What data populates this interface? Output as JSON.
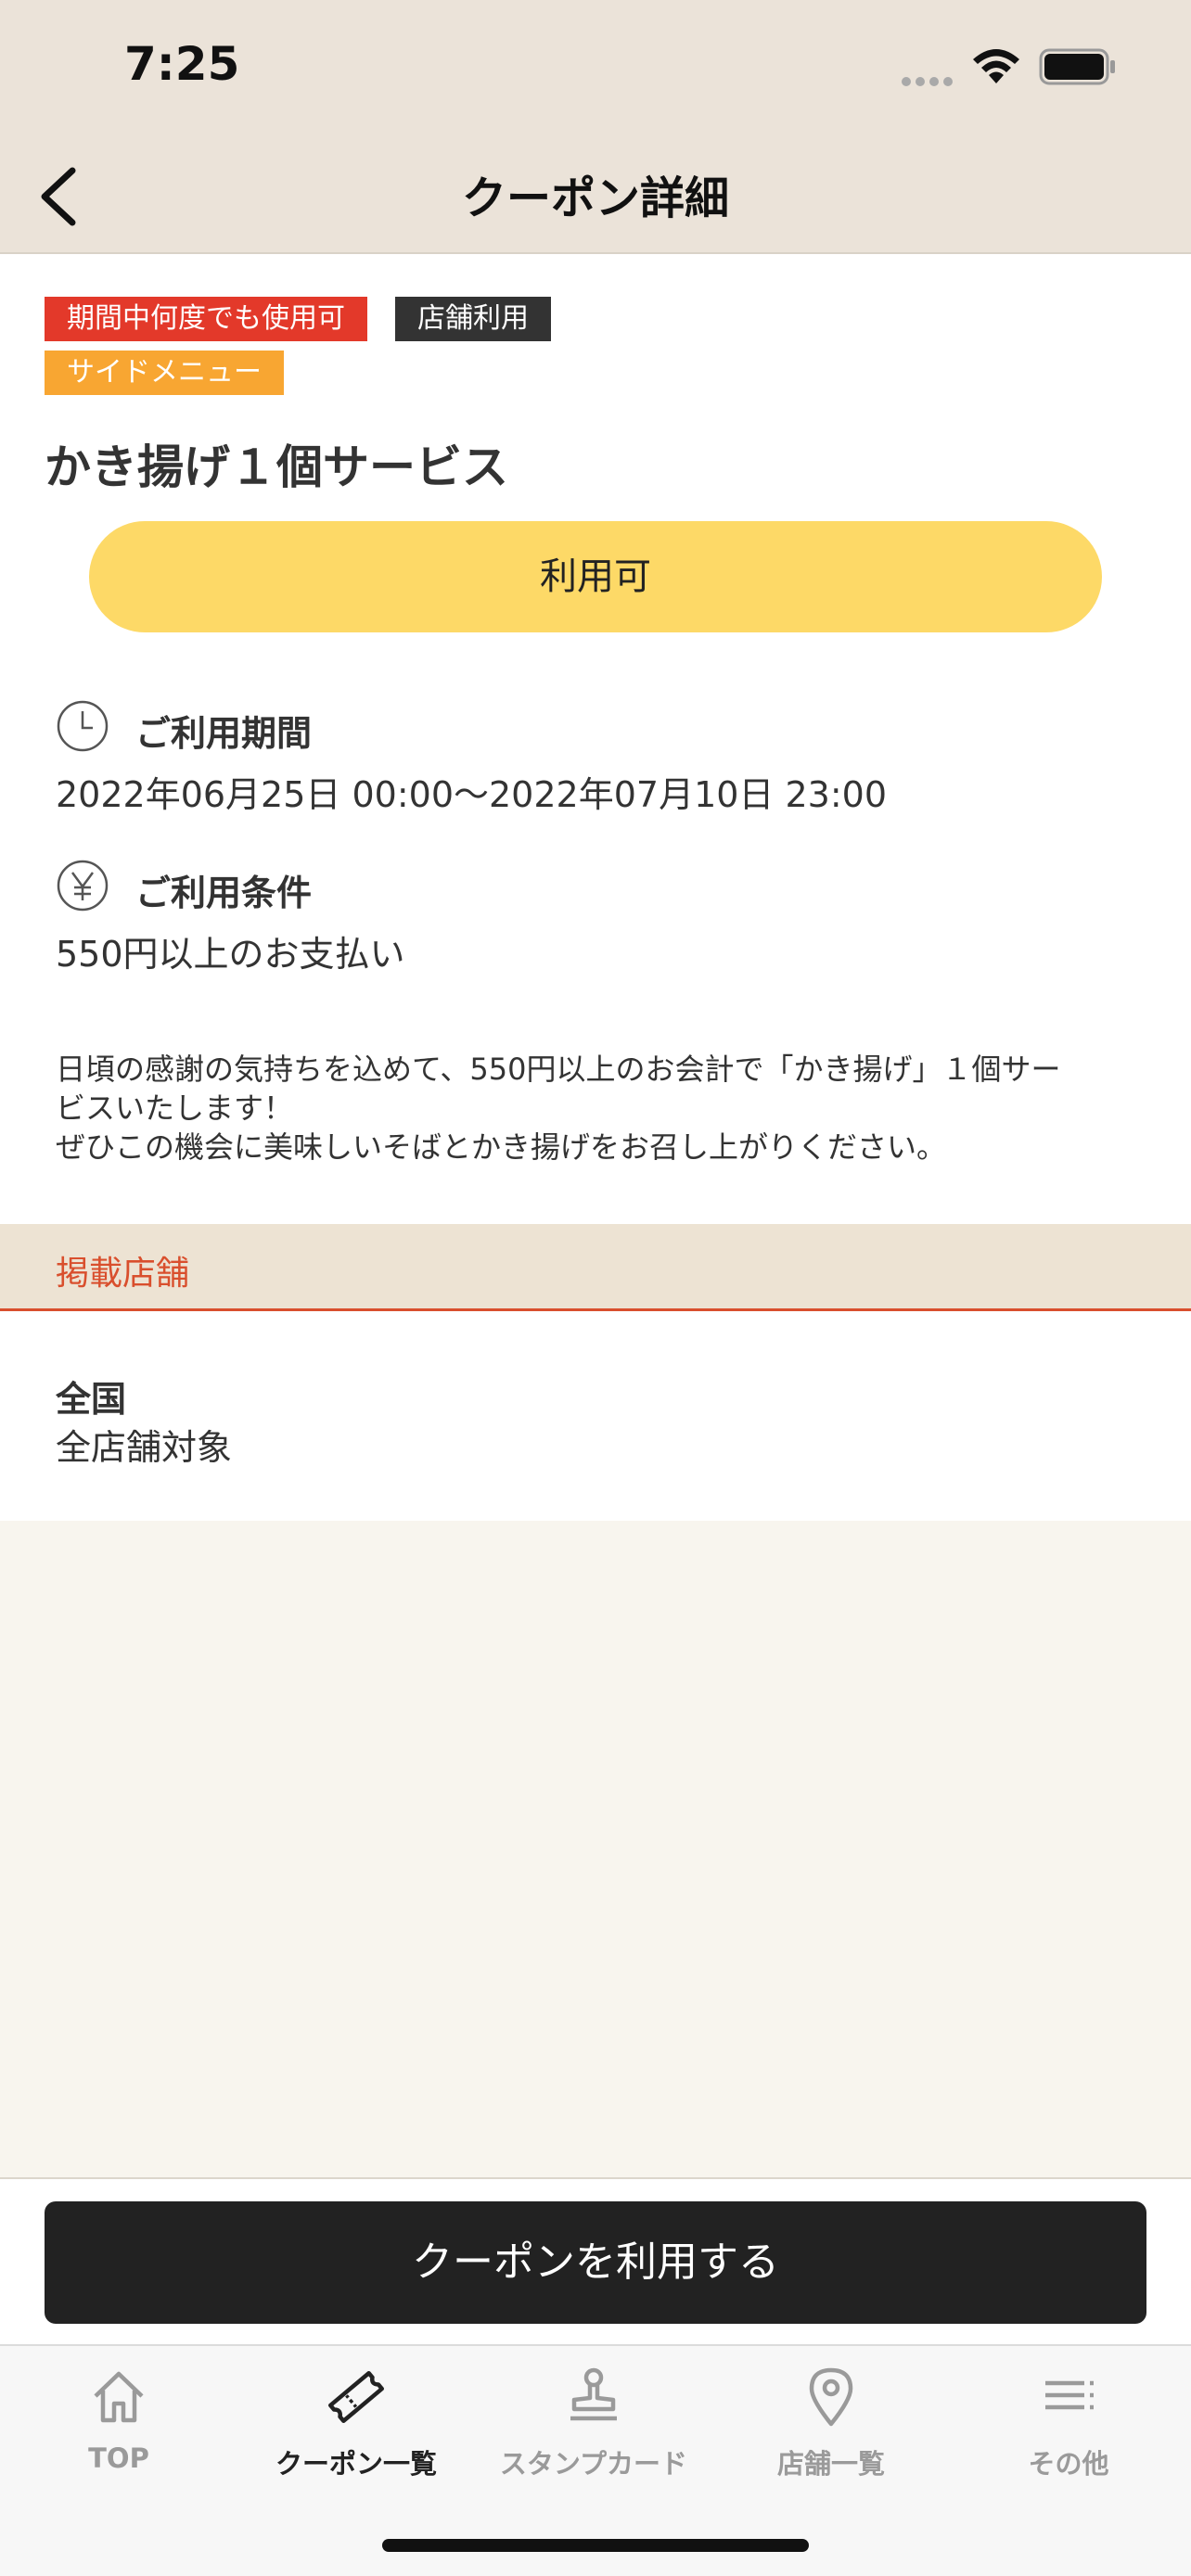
{
  "status_bar": {
    "time": "7:25"
  },
  "nav": {
    "title": "クーポン詳細"
  },
  "coupon": {
    "tags": [
      "期間中何度でも使用可",
      "店舗利用",
      "サイドメニュー"
    ],
    "title": "かき揚げ１個サービス",
    "status": "利用可",
    "period_label": "ご利用期間",
    "period_value": "2022年06月25日 00:00～2022年07月10日 23:00",
    "condition_label": "ご利用条件",
    "condition_value": "550円以上のお支払い",
    "description_lines": [
      "日頃の感謝の気持ちを込めて、550円以上のお会計で「かき揚げ」１個サー",
      "ビスいたします！",
      "ぜひこの機会に美味しいそばとかき揚げをお召し上がりください。"
    ]
  },
  "stores": {
    "header": "掲載店舗",
    "region": "全国",
    "target": "全店舗対象"
  },
  "action": {
    "use_label": "クーポンを利用する"
  },
  "tab_bar": {
    "items": [
      {
        "label": "TOP",
        "icon": "home-icon",
        "active": false
      },
      {
        "label": "クーポン一覧",
        "icon": "ticket-icon",
        "active": true
      },
      {
        "label": "スタンプカード",
        "icon": "stamp-icon",
        "active": false
      },
      {
        "label": "店舗一覧",
        "icon": "location-pin-icon",
        "active": false
      },
      {
        "label": "その他",
        "icon": "menu-icon",
        "active": false
      }
    ]
  },
  "colors": {
    "tag_red": "#e3392a",
    "tag_dark": "#333333",
    "tag_orange": "#f8a632",
    "status_yellow": "#fdd967",
    "accent_red": "#d94f2d"
  }
}
